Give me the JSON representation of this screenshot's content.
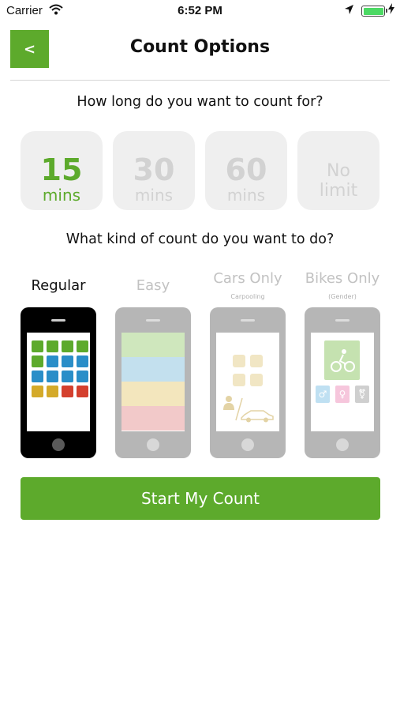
{
  "status_bar": {
    "carrier": "Carrier",
    "time": "6:52 PM",
    "wifi_icon": "wifi-icon",
    "location_icon": "location-arrow-icon",
    "battery_icon": "battery-icon",
    "charging_icon": "charging-bolt-icon",
    "battery_level": 1.0
  },
  "header": {
    "back_label": "<",
    "title": "Count Options"
  },
  "duration": {
    "question": "How long do you want to count for?",
    "options": [
      {
        "number": "15",
        "unit": "mins",
        "selected": true
      },
      {
        "number": "30",
        "unit": "mins",
        "selected": false
      },
      {
        "number": "60",
        "unit": "mins",
        "selected": false
      },
      {
        "line1": "No",
        "line2": "limit",
        "selected": false
      }
    ]
  },
  "count_type": {
    "question": "What kind of count do you want to do?",
    "options": [
      {
        "label": "Regular",
        "sub": "",
        "selected": true
      },
      {
        "label": "Easy",
        "sub": "",
        "selected": false
      },
      {
        "label": "Cars Only",
        "sub": "Carpooling",
        "selected": false
      },
      {
        "label": "Bikes Only",
        "sub": "(Gender)",
        "selected": false
      }
    ]
  },
  "previews": {
    "regular_tiles": [
      "#5daa2c",
      "#5daa2c",
      "#5daa2c",
      "#5daa2c",
      "#5daa2c",
      "#2a8ec8",
      "#2a8ec8",
      "#2a8ec8",
      "#2a8ec8",
      "#2a8ec8",
      "#2a8ec8",
      "#2a8ec8",
      "#d4aa2a",
      "#d4aa2a",
      "#d4402e",
      "#d4402e"
    ],
    "easy_bands": [
      "#cfe7bd",
      "#c3e0ee",
      "#f3e6bd",
      "#f2c9c9"
    ],
    "cars_icons": [
      "person-icon",
      "car-icon"
    ],
    "bikes_icons": [
      "cyclist-icon",
      "male-symbol-icon",
      "female-symbol-icon",
      "transgender-symbol-icon"
    ],
    "gender_colors": [
      "#bfe0f2",
      "#f6c6dc",
      "#cfcfcf"
    ]
  },
  "start_button": {
    "label": "Start My Count"
  },
  "colors": {
    "accent": "#5daa2c",
    "inactive": "#d2d2d2",
    "tile_bg": "#efefef"
  }
}
